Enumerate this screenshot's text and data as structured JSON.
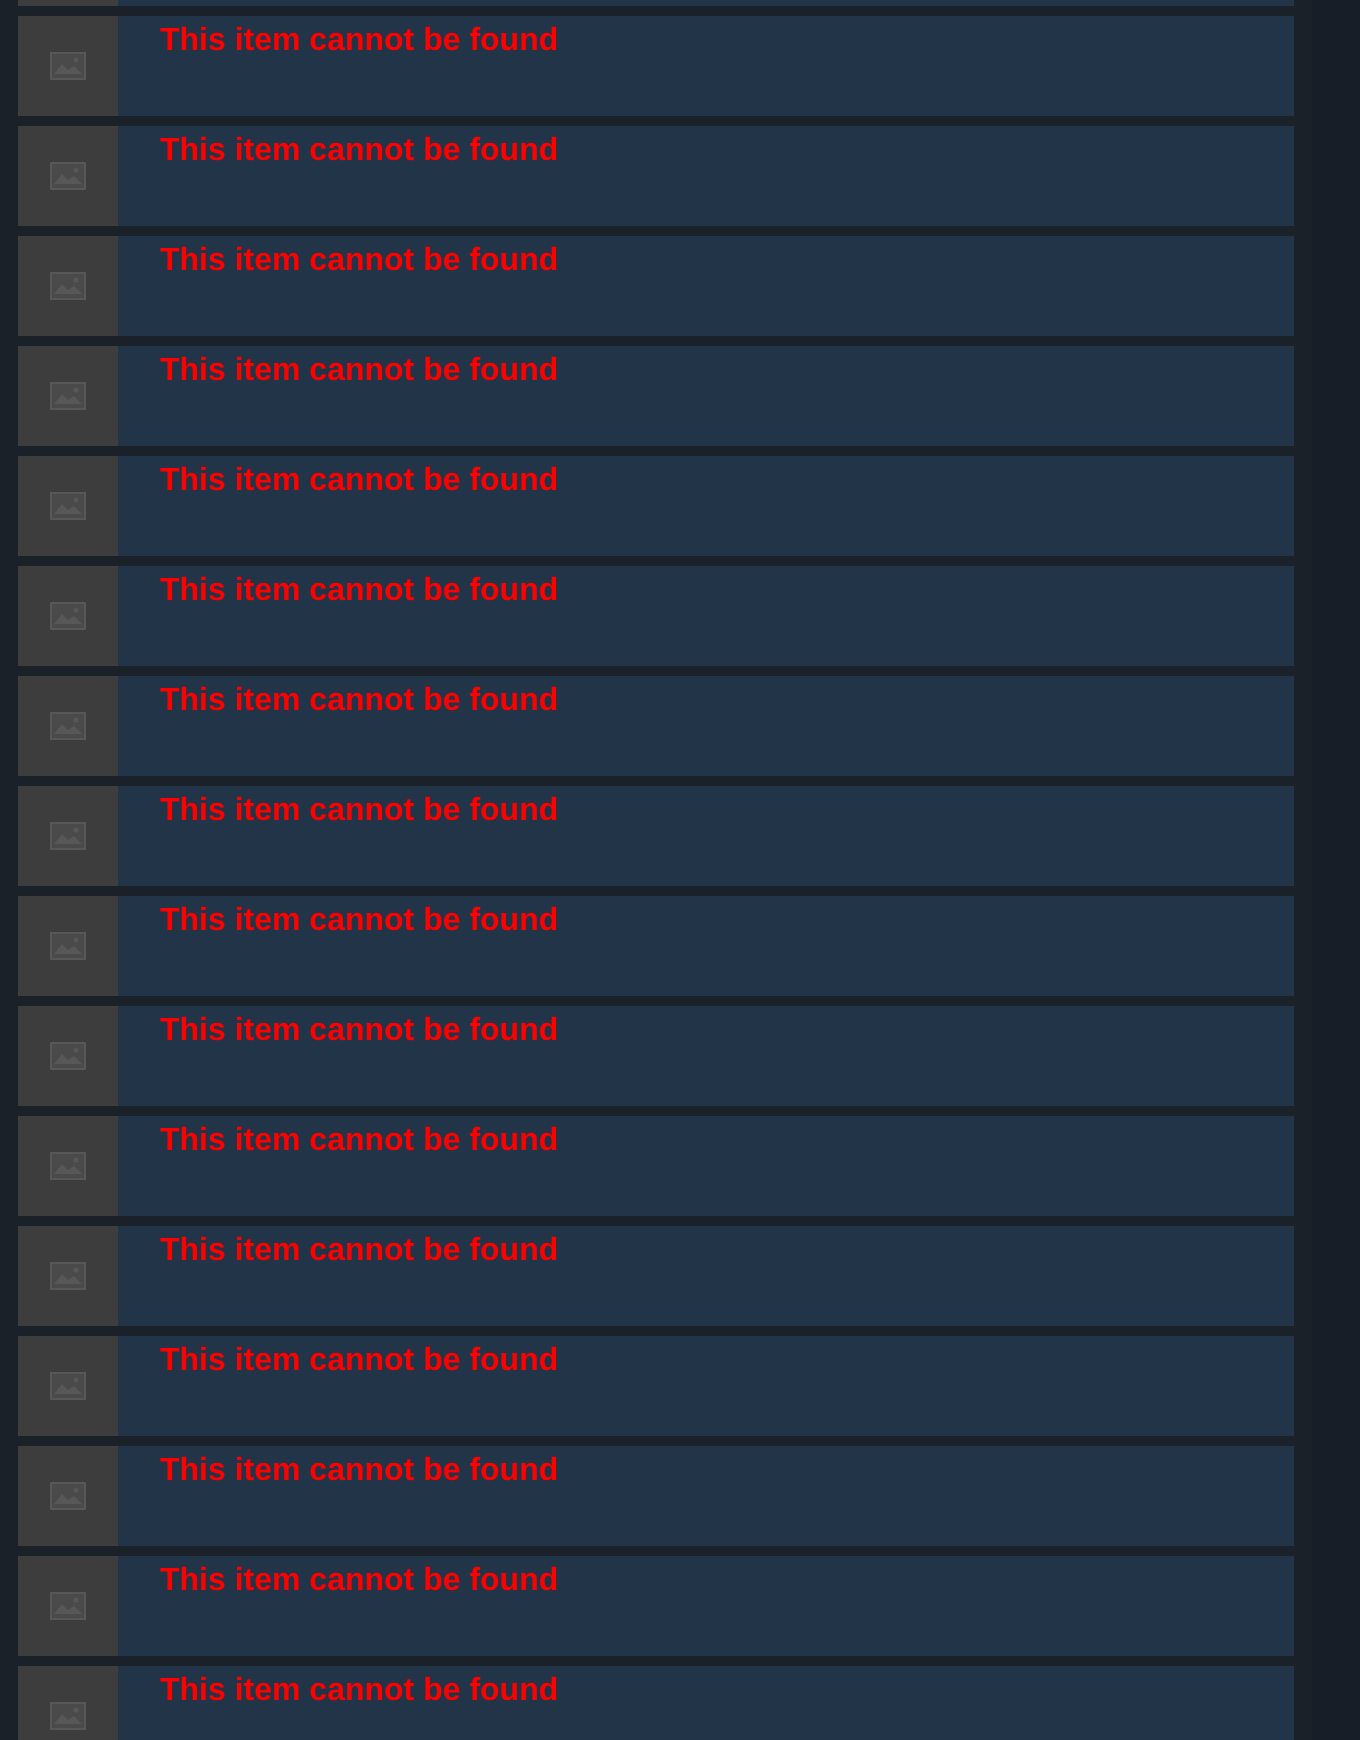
{
  "items": [
    {
      "message": "This item cannot be found"
    },
    {
      "message": "This item cannot be found"
    },
    {
      "message": "This item cannot be found"
    },
    {
      "message": "This item cannot be found"
    },
    {
      "message": "This item cannot be found"
    },
    {
      "message": "This item cannot be found"
    },
    {
      "message": "This item cannot be found"
    },
    {
      "message": "This item cannot be found"
    },
    {
      "message": "This item cannot be found"
    },
    {
      "message": "This item cannot be found"
    },
    {
      "message": "This item cannot be found"
    },
    {
      "message": "This item cannot be found"
    },
    {
      "message": "This item cannot be found"
    },
    {
      "message": "This item cannot be found"
    },
    {
      "message": "This item cannot be found"
    },
    {
      "message": "This item cannot be found"
    }
  ]
}
